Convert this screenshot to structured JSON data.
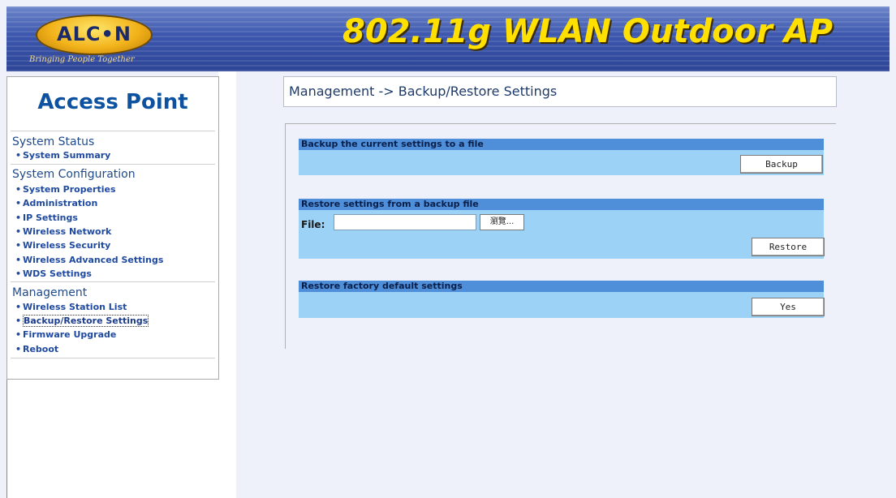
{
  "header": {
    "logo_text": "ALC•N",
    "tagline": "Bringing People Together",
    "title": "802.11g WLAN Outdoor AP"
  },
  "sidebar": {
    "title": "Access Point",
    "sections": [
      {
        "heading": "System Status",
        "items": [
          "System Summary"
        ]
      },
      {
        "heading": "System Configuration",
        "items": [
          "System Properties",
          "Administration",
          "IP Settings",
          "Wireless Network",
          "Wireless Security",
          "Wireless Advanced Settings",
          "WDS Settings"
        ]
      },
      {
        "heading": "Management",
        "items": [
          "Wireless Station List",
          "Backup/Restore Settings",
          "Firmware Upgrade",
          "Reboot"
        ]
      }
    ],
    "active_item": "Backup/Restore Settings"
  },
  "main": {
    "breadcrumb": "Management -> Backup/Restore Settings",
    "backup": {
      "heading": "Backup the current settings to a file",
      "button": "Backup"
    },
    "restore": {
      "heading": "Restore settings from a backup file",
      "file_label": "File:",
      "file_value": "",
      "browse_button": "瀏覽...",
      "button": "Restore"
    },
    "factory": {
      "heading": "Restore factory default settings",
      "button": "Yes"
    }
  }
}
